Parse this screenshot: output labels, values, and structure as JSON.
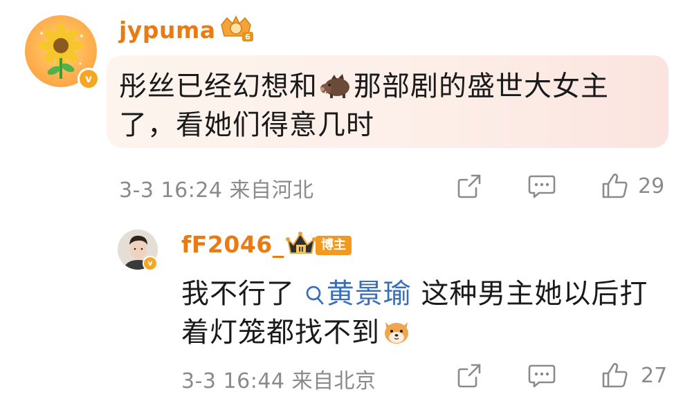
{
  "comment": {
    "username": "jypuma",
    "level_badge": "6",
    "avatar_icon": "sunflower-avatar",
    "verified_icon": "v-badge-icon",
    "text_line1_a": "彤丝已经幻想和",
    "inline_emoji_1": "boar-emoji",
    "text_line1_b": "那部剧的盛世大女主",
    "text_line2": "了，看她们得意几时",
    "meta": "3-3 16:24 来自河北",
    "like_count": "29",
    "icons": [
      "share-icon",
      "comment-icon",
      "like-icon"
    ]
  },
  "reply": {
    "username": "fF2046_",
    "rank_badge": "II",
    "blogger_tag": "博主",
    "text_line1_a": "我不行了",
    "mention": "黄景瑜",
    "text_line1_b": "这种男主她以后打",
    "text_line2": "着灯笼都找不到",
    "inline_emoji_2": "shiba-dog-emoji",
    "meta": "3-3 16:44 来自北京",
    "like_count": "27"
  },
  "colors": {
    "username": "#ea7a12",
    "mention": "#3a6fb8",
    "meta": "#8a8a8a",
    "bubble": "#fdeee8",
    "blogger_tag": "#f19a1f"
  }
}
